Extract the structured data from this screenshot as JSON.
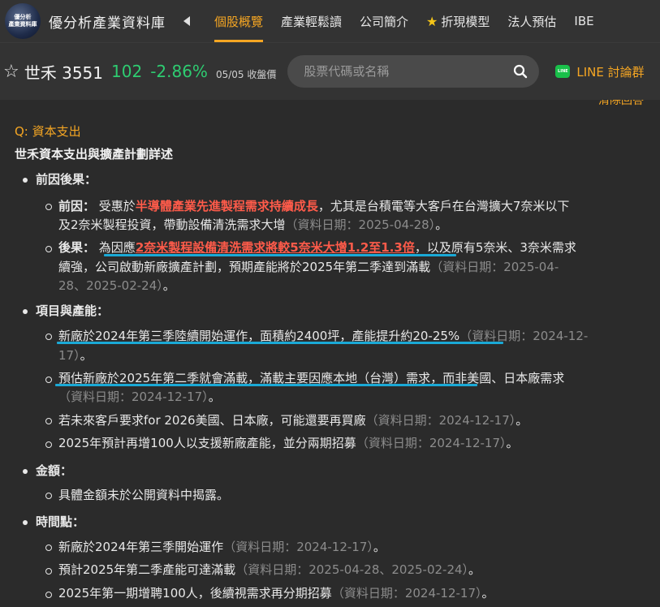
{
  "brand": {
    "logo_text": [
      "優分析",
      "產業資料庫"
    ],
    "name": "優分析產業資料庫"
  },
  "nav": {
    "tabs": [
      {
        "label": "個股概覽",
        "active": true
      },
      {
        "label": "產業輕鬆讀"
      },
      {
        "label": "公司簡介"
      },
      {
        "label": "折現模型",
        "icon": "star-icon"
      },
      {
        "label": "法人預估"
      },
      {
        "label": "IBE"
      }
    ]
  },
  "stock": {
    "name_code": "世禾 3551",
    "price": "102",
    "change": "-2.86%",
    "date": "05/05 收盤價",
    "up_color": "#2ecc71"
  },
  "search": {
    "placeholder": "股票代碼或名稱"
  },
  "line": {
    "label": "LINE 討論群"
  },
  "content": {
    "partial_link": "清除回答",
    "question": "Q: 資本支出",
    "title": "世禾資本支出與擴產計劃詳述",
    "sections": [
      {
        "heading": "前因後果："
      },
      {
        "heading": "項目與產能："
      },
      {
        "heading": "金額："
      },
      {
        "heading": "時間點："
      }
    ],
    "b1_label": "前因：",
    "b1_pre": "受惠於",
    "b1_red": "半導體產業先進製程需求持續成長",
    "b1_post": "，尤其是台積電等大客戶在台灣擴大7奈米以下",
    "b1_line2": "及2奈米製程投資，帶動設備清洗需求大增",
    "b1_src": "（資料日期：2025-04-28）",
    "b1_end": "。",
    "b2_label": "後果：",
    "b2_pre": "為因應",
    "b2_red": "2奈米製程設備清洗需求將較5奈米大增1.2至1.3倍",
    "b2_post": "，以及原有5奈米、3奈米需求",
    "b2_line2": "續強，公司啟動新廠擴產計劃，預期產能將於2025年第二季達到滿載",
    "b2_src1": "（資料日期：2025-04-",
    "b2_src2": "28、2025-02-24）",
    "b2_end": "。",
    "c1": "新廠於2024年第三季陸續開始運作，面積約2400坪，產能提升約20-25%",
    "c1_src1": "（資料日期：2024-12-",
    "c1_src2": "17）",
    "c1_end": "。",
    "c2": "預估新廠於2025年第二季就會滿載，滿載主要因應本地（台灣）需求",
    "c2_post": "，而非美國、日本廠需求",
    "c2_src": "（資料日期：2024-12-17）",
    "c2_end": "。",
    "c3": "若未來客戶要求for 2026美國、日本廠，可能還要再買廠",
    "c3_src": "（資料日期：2024-12-17）",
    "c3_end": "。",
    "c4": "2025年預計再增100人以支援新廠產能，並分兩期招募",
    "c4_src": "（資料日期：2024-12-17）",
    "c4_end": "。",
    "d1": "具體金額未於公開資料中揭露。",
    "e1": "新廠於2024年第三季開始運作",
    "e1_src": "（資料日期：2024-12-17）",
    "e1_end": "。",
    "e2": "預計2025年第二季產能可達滿載",
    "e2_src": "（資料日期：2025-04-28、2025-02-24）",
    "e2_end": "。",
    "e3": "2025年第一期增聘100人，後續視需求再分期招募",
    "e3_src": "（資料日期：2024-12-17）",
    "e3_end": "。"
  },
  "colors": {
    "accent": "#f5a623",
    "highlight": "#ff5b4a",
    "underline": "#1aa9d6",
    "background": "#2b2b2b"
  }
}
